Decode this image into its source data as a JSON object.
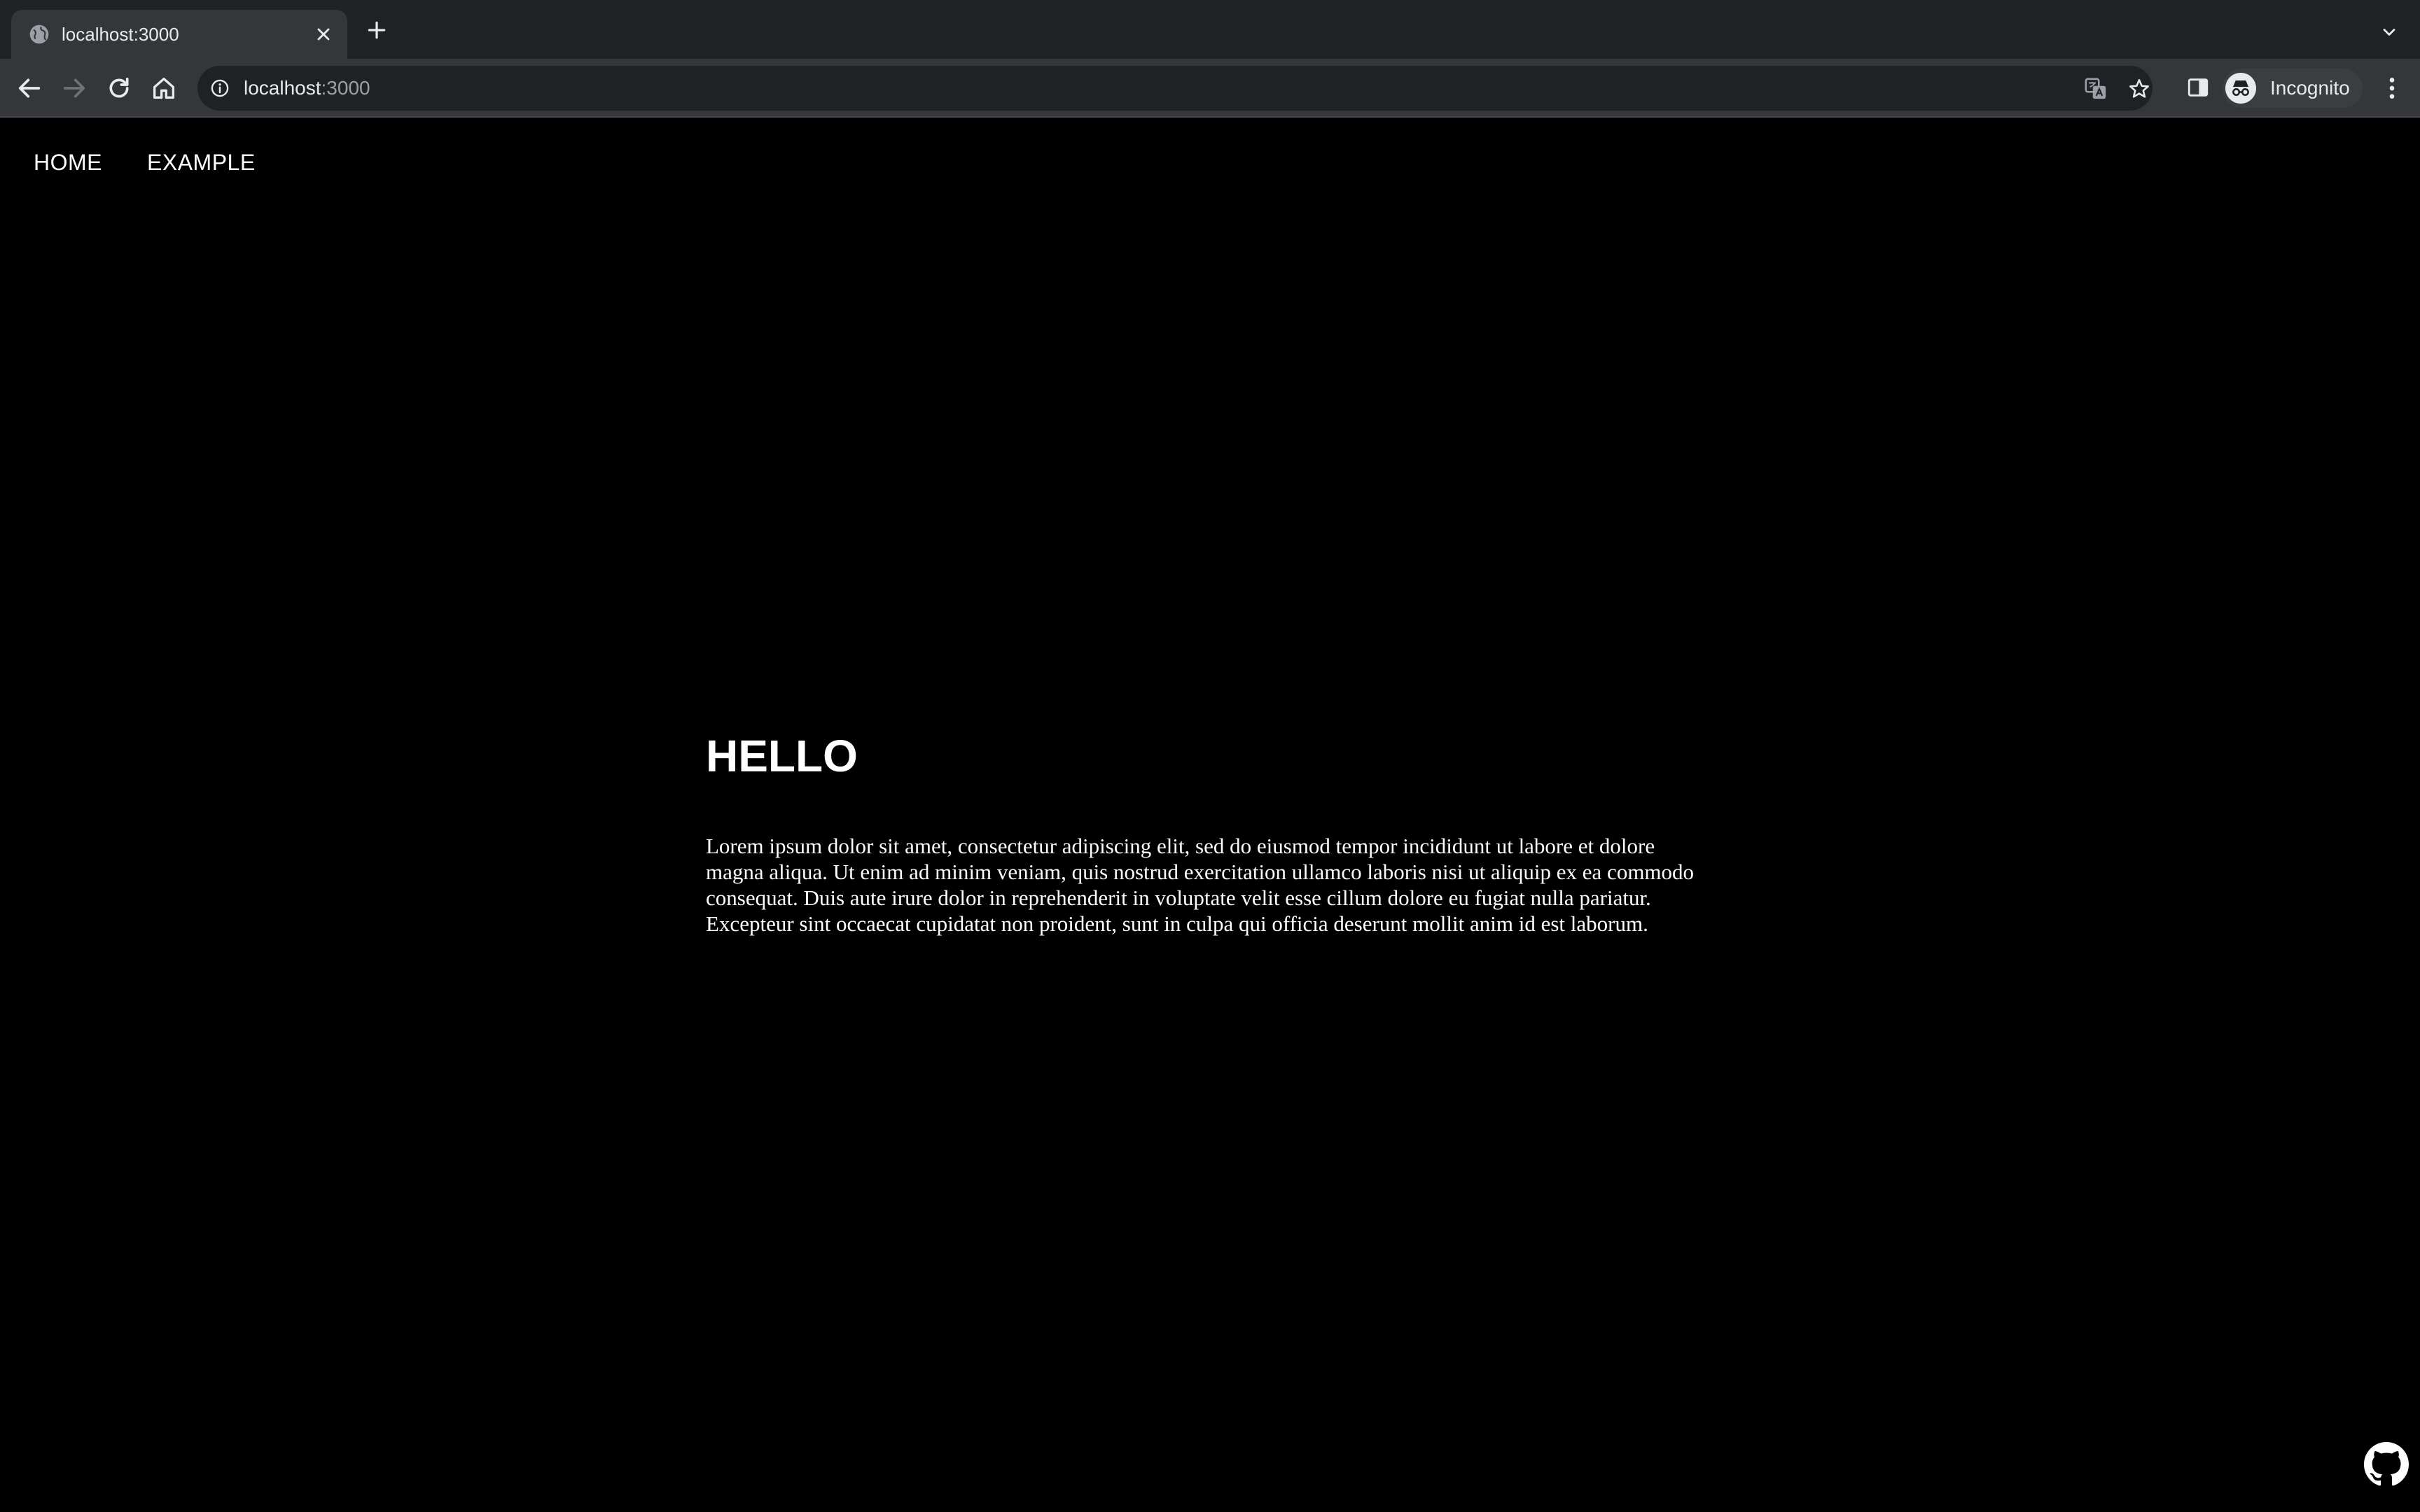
{
  "browser": {
    "tab": {
      "title": "localhost:3000"
    },
    "address_bar": {
      "host": "localhost",
      "port": ":3000"
    },
    "profile": {
      "label": "Incognito"
    }
  },
  "page": {
    "nav": [
      {
        "label": "HOME"
      },
      {
        "label": "EXAMPLE"
      }
    ],
    "heading": "HELLO",
    "paragraph": "Lorem ipsum dolor sit amet, consectetur adipiscing elit, sed do eiusmod tempor incididunt ut labore et dolore magna aliqua. Ut enim ad minim veniam, quis nostrud exercitation ullamco laboris nisi ut aliquip ex ea commodo consequat. Duis aute irure dolor in reprehenderit in voluptate velit esse cillum dolore eu fugiat nulla pariatur. Excepteur sint occaecat cupidatat non proident, sunt in culpa qui officia deserunt mollit anim id est laborum."
  },
  "icons": {
    "favicon": "globe-icon",
    "close": "close-icon",
    "new_tab": "plus-icon",
    "tab_list": "chevron-down-icon",
    "back": "back-arrow-icon",
    "forward": "forward-arrow-icon",
    "reload": "reload-icon",
    "home": "home-icon",
    "site_info": "info-icon",
    "translate": "translate-icon",
    "bookmark": "star-icon",
    "side_panel": "side-panel-icon",
    "incognito": "incognito-icon",
    "menu": "kebab-menu-icon",
    "github": "github-icon"
  },
  "colors": {
    "page_background": "#000000",
    "page_text": "#ffffff",
    "chrome_background": "#202124",
    "toolbar_background": "#35363a"
  }
}
